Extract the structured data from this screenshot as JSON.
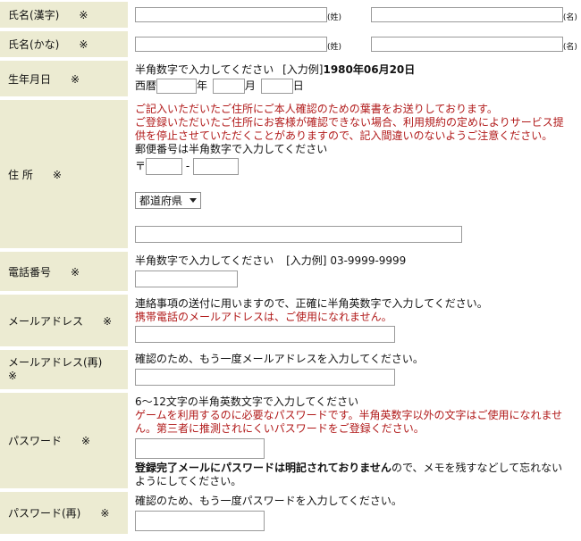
{
  "required_mark": "※",
  "name_kanji": {
    "label": "氏名(漢字)",
    "last_hint": "(姓)",
    "first_hint": "(名)"
  },
  "name_kana": {
    "label": "氏名(かな)",
    "last_hint": "(姓)",
    "first_hint": "(名)"
  },
  "birthdate": {
    "label": "生年月日",
    "instruction": "半角数字で入力してください",
    "example_label": "[入力例]",
    "example_value": "1980年06月20日",
    "era_label": "西暦",
    "year_unit": "年",
    "month_unit": "月",
    "day_unit": "日"
  },
  "address": {
    "label": "住 所",
    "notice_1": "ご記入いただいたご住所にご本人確認のための葉書をお送りしております。",
    "notice_2": "ご登録いただいたご住所にお客様が確認できない場合、利用規約の定めによりサービス提",
    "notice_3": "供を停止させていただくことがありますので、記入間違いのないようご注意ください。",
    "postal_instruction": "郵便番号は半角数字で入力してください",
    "postal_symbol": "〒",
    "postal_dash": "-",
    "prefecture_selected": "都道府県"
  },
  "phone": {
    "label": "電話番号",
    "instruction": "半角数字で入力してください",
    "example_label": "[入力例]",
    "example_value": "03-9999-9999"
  },
  "email": {
    "label": "メールアドレス",
    "instruction": "連絡事項の送付に用いますので、正確に半角英数字で入力してください。",
    "warning_red": "携帯電話",
    "warning_rest": "のメールアドレスは、ご使用になれません。"
  },
  "email_confirm": {
    "label": "メールアドレス(再)",
    "instruction": "確認のため、もう一度メールアドレスを入力してください。"
  },
  "password": {
    "label": "パスワード",
    "instruction": "6～12文字の半角英数文字で入力してください",
    "notice_1": "ゲームを利用するのに必要なパスワードです。半角英数字以外の文字はご使用になれませ",
    "notice_2": "ん。第三者に推測されにくいパスワードをご登録ください。",
    "note_bold": "登録完了メールにパスワードは明記されておりません",
    "note_rest_1": "ので、メモを残すなどして忘れない",
    "note_rest_2": "ようにしてください。"
  },
  "password_confirm": {
    "label": "パスワード(再)",
    "instruction": "確認のため、もう一度パスワードを入力してください。"
  }
}
